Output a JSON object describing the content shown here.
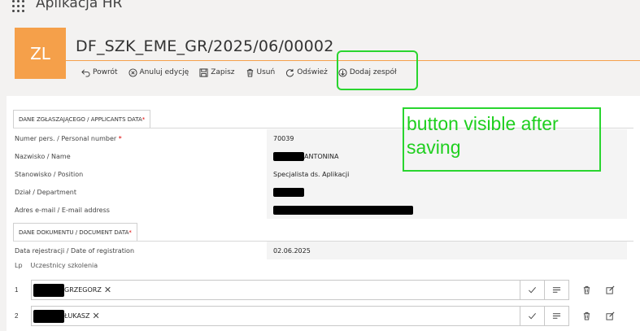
{
  "app": {
    "title": "Aplikacja HR"
  },
  "header": {
    "avatar_initials": "ZL",
    "document_id": "DF_SZK_EME_GR/2025/06/00002"
  },
  "toolbar": {
    "buttons": [
      {
        "label": "Powrót",
        "icon": "undo-arrow-icon"
      },
      {
        "label": "Anuluj edycję",
        "icon": "cancel-circle-icon"
      },
      {
        "label": "Zapisz",
        "icon": "save-icon"
      },
      {
        "label": "Usuń",
        "icon": "trash-icon"
      },
      {
        "label": "Odśwież",
        "icon": "refresh-icon"
      },
      {
        "label": "Dodaj zespół",
        "icon": "download-circle-icon"
      }
    ]
  },
  "annotation": {
    "text": "button visible after\nsaving",
    "color": "#29d52f"
  },
  "sections": {
    "applicant": {
      "title": "DANE ZGŁASZAJĄCEGO / APPLICANTS DATA",
      "required_mark": "*",
      "fields": [
        {
          "label": "Numer pers. / Personal number",
          "required": "*",
          "value": "70039"
        },
        {
          "label": "Nazwisko / Name",
          "required": "",
          "value": "ANTONINA"
        },
        {
          "label": "Stanowisko / Position",
          "required": "",
          "value": "Specjalista ds. Aplikacji"
        },
        {
          "label": "Dział / Department",
          "required": "",
          "value": ""
        },
        {
          "label": "Adres e-mail / E-mail address",
          "required": "",
          "value": ""
        }
      ]
    },
    "document": {
      "title": "DANE DOKUMENTU / DOCUMENT DATA",
      "required_mark": "*",
      "fields": [
        {
          "label": "Data rejestracji / Date of registration",
          "value": "02.06.2025"
        }
      ]
    }
  },
  "participants": {
    "header_lp": "Lp",
    "header_title": "Uczestnicy szkolenia",
    "rows": [
      {
        "no": "1",
        "name": "GRZEGORZ",
        "remove": "✕"
      },
      {
        "no": "2",
        "name": "ŁUKASZ",
        "remove": "✕"
      }
    ]
  },
  "colors": {
    "accent": "#f5a04a",
    "highlight": "#29d52f"
  }
}
